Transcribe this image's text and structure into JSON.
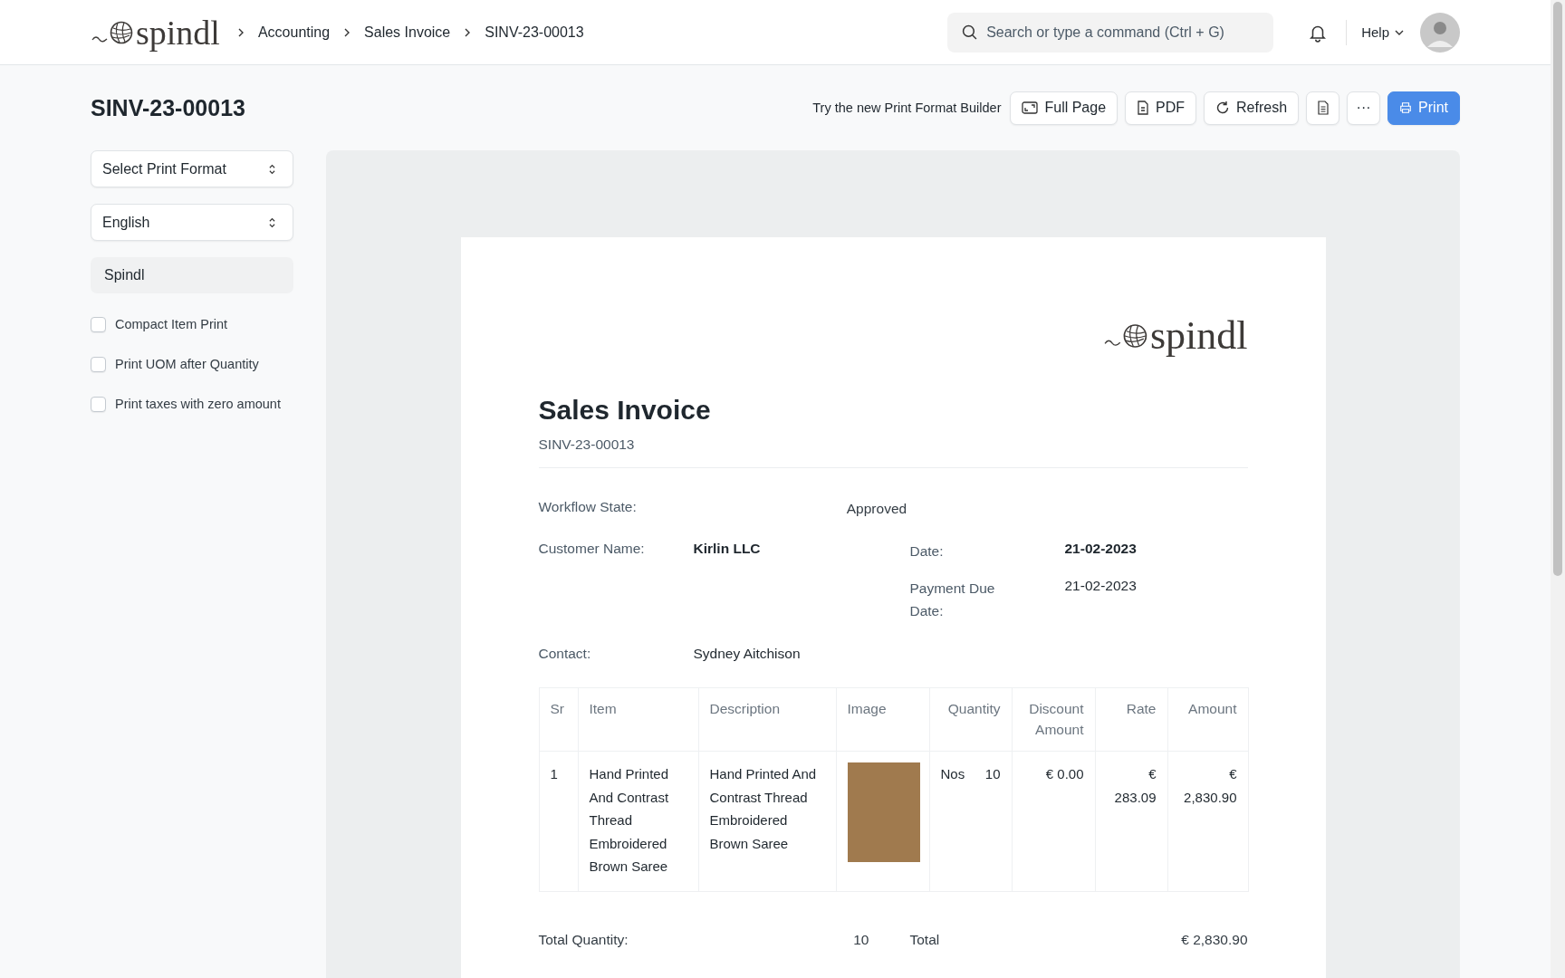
{
  "navbar": {
    "logo": "spindl",
    "breadcrumbs": [
      "Accounting",
      "Sales Invoice",
      "SINV-23-00013"
    ],
    "search": {
      "placeholder": "Search or type a command (Ctrl + G)"
    },
    "help": "Help"
  },
  "page": {
    "title": "SINV-23-00013",
    "builder_link": "Try the new Print Format Builder",
    "buttons": [
      {
        "kind": "fullpage",
        "label": "Full Page"
      },
      {
        "kind": "pdf",
        "label": "PDF"
      },
      {
        "kind": "refresh",
        "label": "Refresh"
      },
      {
        "kind": "doc"
      },
      {
        "kind": "more",
        "label": "···"
      },
      {
        "kind": "print",
        "label": "Print"
      }
    ]
  },
  "sidebar": {
    "selects": [
      {
        "value": "Select Print Format"
      },
      {
        "value": "English"
      }
    ],
    "letterhead": "Spindl",
    "options": [
      {
        "label": "Compact Item Print",
        "checked": false
      },
      {
        "label": "Print UOM after Quantity",
        "checked": false
      },
      {
        "label": "Print taxes with zero amount",
        "checked": false
      }
    ]
  },
  "document": {
    "logo": "spindl",
    "title": "Sales Invoice",
    "number": "SINV-23-00013",
    "workflow": {
      "label": "Workflow State:",
      "value": "Approved"
    },
    "customer": {
      "label": "Customer Name:",
      "value": "Kirlin LLC"
    },
    "date": {
      "label": "Date:",
      "value": "21-02-2023"
    },
    "due": {
      "label": "Payment Due Date:",
      "value": "21-02-2023"
    },
    "contact": {
      "label": "Contact:",
      "value": "Sydney Aitchison"
    },
    "table": {
      "columns": [
        "Sr",
        "Item",
        "Description",
        "Image",
        "Quantity",
        "Discount Amount",
        "Rate",
        "Amount"
      ],
      "rows": [
        {
          "sr": "1",
          "item": "Hand Printed And Contrast Thread Embroidered Brown Saree",
          "description": "Hand Printed And Contrast Thread Embroidered Brown Saree",
          "uom": "Nos",
          "qty": "10",
          "discount": "€ 0.00",
          "rate": "€ 283.09",
          "amount": "€ 2,830.90"
        }
      ]
    },
    "totals": {
      "qty_label": "Total Quantity:",
      "qty": "10",
      "total_label": "Total",
      "total": "€ 2,830.90"
    }
  }
}
